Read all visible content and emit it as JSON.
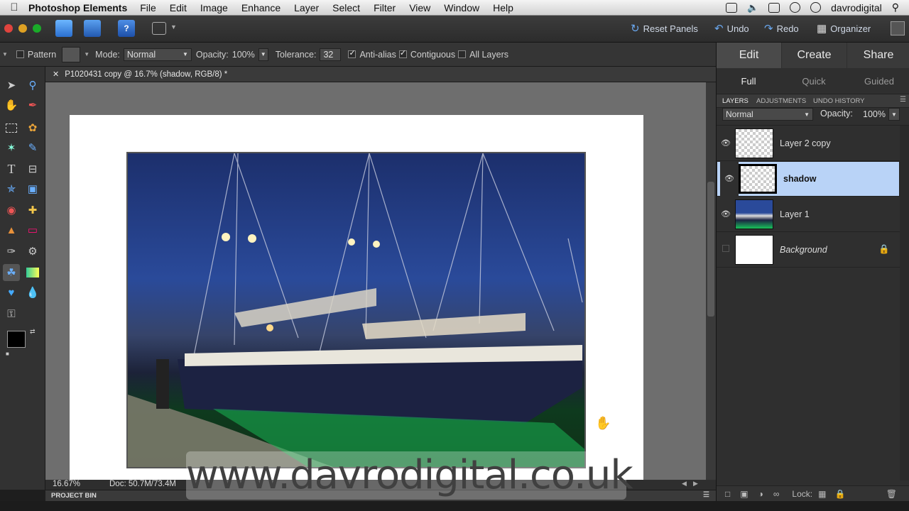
{
  "menubar": {
    "app_name": "Photoshop Elements",
    "items": [
      "File",
      "Edit",
      "Image",
      "Enhance",
      "Layer",
      "Select",
      "Filter",
      "View",
      "Window",
      "Help"
    ],
    "user": "davrodigital"
  },
  "toolbar": {
    "reset_panels": "Reset Panels",
    "undo": "Undo",
    "redo": "Redo",
    "organizer": "Organizer"
  },
  "options": {
    "pattern_label": "Pattern",
    "mode_label": "Mode:",
    "mode_value": "Normal",
    "opacity_label": "Opacity:",
    "opacity_value": "100%",
    "tolerance_label": "Tolerance:",
    "tolerance_value": "32",
    "antialias_label": "Anti-alias",
    "contiguous_label": "Contiguous",
    "all_layers_label": "All Layers"
  },
  "document": {
    "tab_title": "P1020431 copy @ 16.7% (shadow, RGB/8) *",
    "zoom": "16.67%",
    "doc_size": "Doc: 50.7M/73.4M"
  },
  "project_bin": "PROJECT BIN",
  "panel": {
    "main_tabs": [
      "Edit",
      "Create",
      "Share"
    ],
    "sub_tabs": [
      "Full",
      "Quick",
      "Guided"
    ],
    "panel_tabs": [
      "LAYERS",
      "ADJUSTMENTS",
      "UNDO HISTORY"
    ],
    "blend_mode": "Normal",
    "opacity_label": "Opacity:",
    "opacity_value": "100%",
    "layers": [
      {
        "name": "Layer 2 copy"
      },
      {
        "name": "shadow"
      },
      {
        "name": "Layer 1"
      },
      {
        "name": "Background"
      }
    ],
    "lock_label": "Lock:"
  },
  "watermark": "www.davrodigital.co.uk",
  "colors": {
    "selected_layer": "#b9d3f7",
    "accent_blue": "#6aa8f0"
  }
}
